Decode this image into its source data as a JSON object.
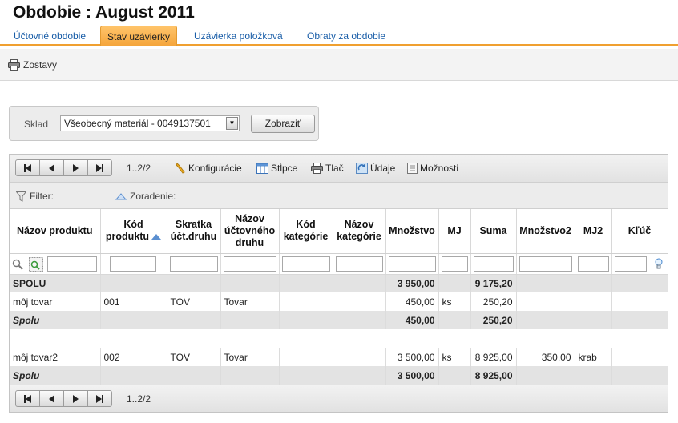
{
  "page": {
    "title": "Obdobie :  August 2011"
  },
  "tabs": [
    {
      "label": "Účtovné obdobie"
    },
    {
      "label": "Stav uzávierky"
    },
    {
      "label": "Uzávierka položková"
    },
    {
      "label": "Obraty za obdobie"
    }
  ],
  "toolbar": {
    "zostavy_label": "Zostavy"
  },
  "filter_box": {
    "sklad_label": "Sklad",
    "sklad_value": "Všeobecný materiál - 0049137501",
    "show_button": "Zobraziť"
  },
  "grid": {
    "page_range": "1..2/2",
    "tools": {
      "config": "Konfigurácie",
      "columns": "Stĺpce",
      "print": "Tlač",
      "data": "Údaje",
      "options": "Možnosti"
    },
    "filter_label": "Filter:",
    "sort_label": "Zoradenie:",
    "columns": [
      "Názov produktu",
      "Kód produktu",
      "Skratka účt.druhu",
      "Názov účtovného druhu",
      "Kód kategórie",
      "Názov kategórie",
      "Množstvo",
      "MJ",
      "Suma",
      "Množstvo2",
      "MJ2",
      "Kľúč"
    ],
    "total_row": {
      "label": "SPOLU",
      "mnozstvo": "3 950,00",
      "suma": "9 175,20"
    },
    "groups": [
      {
        "rows": [
          {
            "nazov": "môj tovar",
            "kod": "001",
            "skratka": "TOV",
            "druh": "Tovar",
            "kat_kod": "",
            "kat_nazov": "",
            "mnozstvo": "450,00",
            "mj": "ks",
            "suma": "250,20",
            "mnozstvo2": "",
            "mj2": "",
            "kluc": ""
          }
        ],
        "subtotal": {
          "label": "Spolu",
          "mnozstvo": "450,00",
          "suma": "250,20"
        }
      },
      {
        "rows": [
          {
            "nazov": "môj tovar2",
            "kod": "002",
            "skratka": "TOV",
            "druh": "Tovar",
            "kat_kod": "",
            "kat_nazov": "",
            "mnozstvo": "3 500,00",
            "mj": "ks",
            "suma": "8 925,00",
            "mnozstvo2": "350,00",
            "mj2": "krab",
            "kluc": ""
          }
        ],
        "subtotal": {
          "label": "Spolu",
          "mnozstvo": "3 500,00",
          "suma": "8 925,00"
        }
      }
    ]
  }
}
